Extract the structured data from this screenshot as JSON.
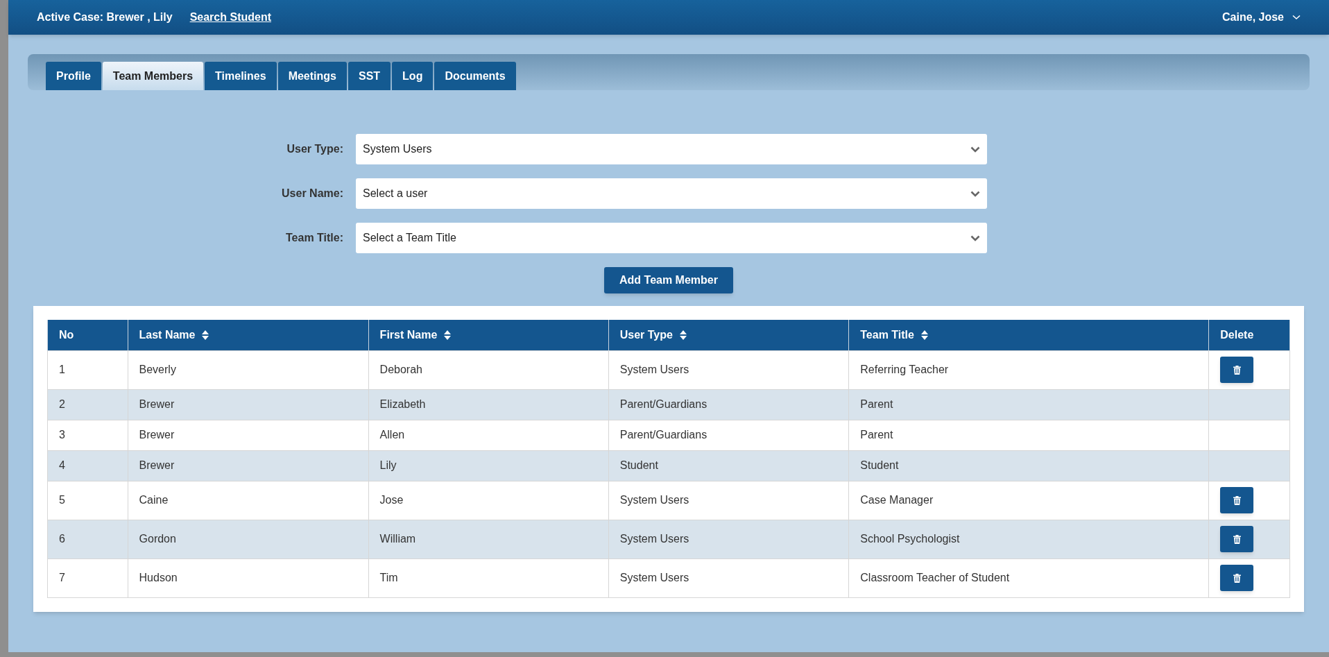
{
  "header": {
    "active_case": "Active Case: Brewer , Lily",
    "search_link": "Search Student",
    "user_menu": "Caine, Jose"
  },
  "tabs": [
    {
      "label": "Profile",
      "selected": false
    },
    {
      "label": "Team Members",
      "selected": true
    },
    {
      "label": "Timelines",
      "selected": false
    },
    {
      "label": "Meetings",
      "selected": false
    },
    {
      "label": "SST",
      "selected": false
    },
    {
      "label": "Log",
      "selected": false
    },
    {
      "label": "Documents",
      "selected": false
    }
  ],
  "form": {
    "fields": [
      {
        "label": "User Type:",
        "value": "System Users"
      },
      {
        "label": "User Name:",
        "value": "Select a user"
      },
      {
        "label": "Team Title:",
        "value": "Select a Team Title"
      }
    ],
    "add_button": "Add Team Member"
  },
  "table": {
    "columns": [
      {
        "label": "No",
        "sortable": false
      },
      {
        "label": "Last Name",
        "sortable": true
      },
      {
        "label": "First Name",
        "sortable": true
      },
      {
        "label": "User Type",
        "sortable": true
      },
      {
        "label": "Team Title",
        "sortable": true
      },
      {
        "label": "Delete",
        "sortable": false
      }
    ],
    "rows": [
      {
        "cells": [
          "1",
          "Beverly",
          "Deborah",
          "System Users",
          "Referring Teacher"
        ],
        "deletable": true
      },
      {
        "cells": [
          "2",
          "Brewer",
          "Elizabeth",
          "Parent/Guardians",
          "Parent"
        ],
        "deletable": false
      },
      {
        "cells": [
          "3",
          "Brewer",
          "Allen",
          "Parent/Guardians",
          "Parent"
        ],
        "deletable": false
      },
      {
        "cells": [
          "4",
          "Brewer",
          "Lily",
          "Student",
          "Student"
        ],
        "deletable": false
      },
      {
        "cells": [
          "5",
          "Caine",
          "Jose",
          "System Users",
          "Case Manager"
        ],
        "deletable": true
      },
      {
        "cells": [
          "6",
          "Gordon",
          "William",
          "System Users",
          "School Psychologist"
        ],
        "deletable": true
      },
      {
        "cells": [
          "7",
          "Hudson",
          "Tim",
          "System Users",
          "Classroom Teacher of Student"
        ],
        "deletable": true
      }
    ]
  }
}
